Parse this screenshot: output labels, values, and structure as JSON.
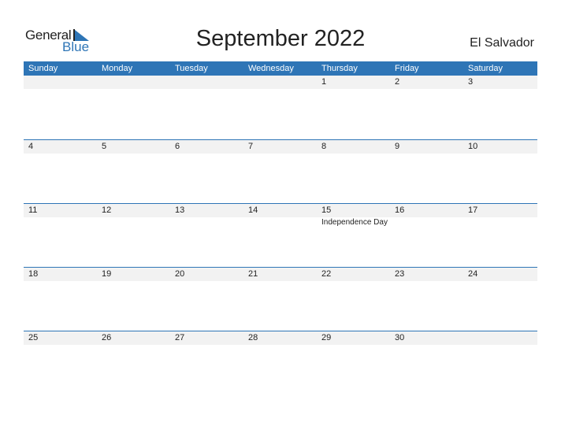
{
  "logo": {
    "general": "General",
    "blue": "Blue"
  },
  "title": "September 2022",
  "country": "El Salvador",
  "colors": {
    "accent": "#2e75b6",
    "row_bg": "#f2f2f2"
  },
  "weekdays": [
    "Sunday",
    "Monday",
    "Tuesday",
    "Wednesday",
    "Thursday",
    "Friday",
    "Saturday"
  ],
  "weeks": [
    {
      "days": [
        "",
        "",
        "",
        "",
        "1",
        "2",
        "3"
      ],
      "events": [
        "",
        "",
        "",
        "",
        "",
        "",
        ""
      ]
    },
    {
      "days": [
        "4",
        "5",
        "6",
        "7",
        "8",
        "9",
        "10"
      ],
      "events": [
        "",
        "",
        "",
        "",
        "",
        "",
        ""
      ]
    },
    {
      "days": [
        "11",
        "12",
        "13",
        "14",
        "15",
        "16",
        "17"
      ],
      "events": [
        "",
        "",
        "",
        "",
        "Independence Day",
        "",
        ""
      ]
    },
    {
      "days": [
        "18",
        "19",
        "20",
        "21",
        "22",
        "23",
        "24"
      ],
      "events": [
        "",
        "",
        "",
        "",
        "",
        "",
        ""
      ]
    },
    {
      "days": [
        "25",
        "26",
        "27",
        "28",
        "29",
        "30",
        ""
      ],
      "events": [
        "",
        "",
        "",
        "",
        "",
        "",
        ""
      ]
    }
  ]
}
